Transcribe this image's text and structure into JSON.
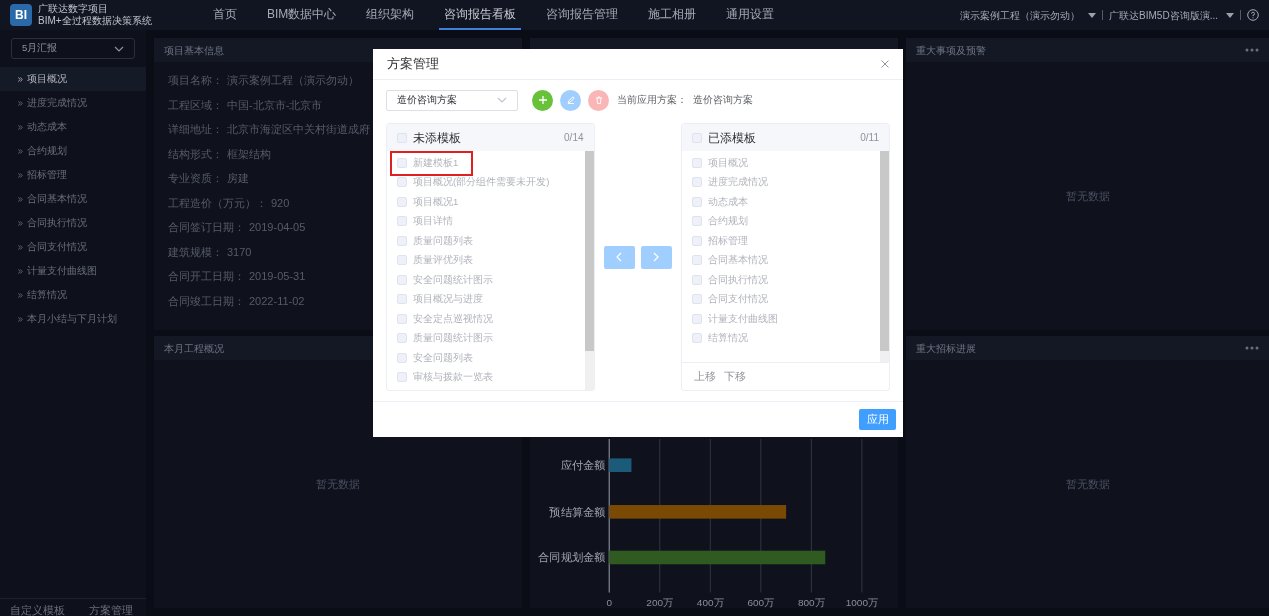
{
  "header": {
    "logo": "BI",
    "app_title": "广联达数字项目",
    "app_subtitle": "BIM+全过程数据决策系统",
    "nav": [
      {
        "label": "首页",
        "selected": false
      },
      {
        "label": "BIM数据中心",
        "selected": false
      },
      {
        "label": "组织架构",
        "selected": false
      },
      {
        "label": "咨询报告看板",
        "selected": true
      },
      {
        "label": "咨询报告管理",
        "selected": false
      },
      {
        "label": "施工相册",
        "selected": false
      },
      {
        "label": "通用设置",
        "selected": false
      }
    ],
    "project": "演示案例工程（演示勿动）",
    "company": "广联达BIM5D咨询版演..."
  },
  "sidebar": {
    "report_select": "5月汇报",
    "items": [
      {
        "label": "项目概况",
        "selected": true
      },
      {
        "label": "进度完成情况",
        "selected": false
      },
      {
        "label": "动态成本",
        "selected": false
      },
      {
        "label": "合约规划",
        "selected": false
      },
      {
        "label": "招标管理",
        "selected": false
      },
      {
        "label": "合同基本情况",
        "selected": false
      },
      {
        "label": "合同执行情况",
        "selected": false
      },
      {
        "label": "合同支付情况",
        "selected": false
      },
      {
        "label": "计量支付曲线图",
        "selected": false
      },
      {
        "label": "结算情况",
        "selected": false
      },
      {
        "label": "本月小结与下月计划",
        "selected": false
      }
    ],
    "footer_links": [
      "自定义模板",
      "方案管理"
    ]
  },
  "panels": {
    "basic_info": {
      "title": "项目基本信息",
      "rows": [
        {
          "label": "项目名称：",
          "value": "演示案例工程（演示勿动）"
        },
        {
          "label": "工程区域：",
          "value": "中国-北京市-北京市"
        },
        {
          "label": "详细地址：",
          "value": "北京市海淀区中关村街道成府"
        },
        {
          "label": "结构形式：",
          "value": "框架结构"
        },
        {
          "label": "专业资质：",
          "value": "房建"
        },
        {
          "label": "工程造价（万元）：",
          "value": "920"
        },
        {
          "label": "合同签订日期：",
          "value": "2019-04-05"
        },
        {
          "label": "建筑规模：",
          "value": "3170"
        },
        {
          "label": "合同开工日期：",
          "value": "2019-05-31"
        },
        {
          "label": "合同竣工日期：",
          "value": "2022-11-02"
        }
      ]
    },
    "monthly": {
      "title": "本月工程概况",
      "empty": "暂无数据"
    },
    "events": {
      "title": "重大事项及预警",
      "empty": "暂无数据"
    },
    "tenders": {
      "title": "重大招标进展",
      "empty": "暂无数据"
    },
    "amounts": {
      "chart_data": {
        "type": "bar",
        "orientation": "horizontal",
        "categories": [
          "应付金额",
          "预结算金额",
          "合同规划金额"
        ],
        "values": [
          88,
          700,
          855
        ],
        "grid": true,
        "xlim": [
          0,
          1000
        ],
        "xticks": [
          {
            "value": 0,
            "label": "0"
          },
          {
            "value": 200,
            "label": "200万"
          },
          {
            "value": 400,
            "label": "400万"
          },
          {
            "value": 600,
            "label": "600万"
          },
          {
            "value": 800,
            "label": "800万"
          },
          {
            "value": 1000,
            "label": "1000万"
          }
        ]
      }
    }
  },
  "modal": {
    "title": "方案管理",
    "plan_select": "造价咨询方案",
    "current_label": "当前应用方案：",
    "current_value": "造价咨询方案",
    "available": {
      "title": "未添模板",
      "count": "0/14",
      "checked": false,
      "items": [
        {
          "label": "新建模板1",
          "checked": false
        },
        {
          "label": "项目概况(部分组件需要未开发)",
          "checked": false
        },
        {
          "label": "项目概况1",
          "checked": false
        },
        {
          "label": "项目详情",
          "checked": false
        },
        {
          "label": "质量问题列表",
          "checked": false
        },
        {
          "label": "质量评优列表",
          "checked": false
        },
        {
          "label": "安全问题统计图示",
          "checked": false
        },
        {
          "label": "项目概况与进度",
          "checked": false
        },
        {
          "label": "安全定点巡视情况",
          "checked": false
        },
        {
          "label": "质量问题统计图示",
          "checked": false
        },
        {
          "label": "安全问题列表",
          "checked": false
        },
        {
          "label": "审核与拨款一览表",
          "checked": false
        }
      ]
    },
    "added": {
      "title": "已添模板",
      "count": "0/11",
      "checked": false,
      "items": [
        {
          "label": "项目概况",
          "checked": false
        },
        {
          "label": "进度完成情况",
          "checked": false
        },
        {
          "label": "动态成本",
          "checked": false
        },
        {
          "label": "合约规划",
          "checked": false
        },
        {
          "label": "招标管理",
          "checked": false
        },
        {
          "label": "合同基本情况",
          "checked": false
        },
        {
          "label": "合同执行情况",
          "checked": false
        },
        {
          "label": "合同支付情况",
          "checked": false
        },
        {
          "label": "计量支付曲线图",
          "checked": false
        },
        {
          "label": "结算情况",
          "checked": false
        }
      ],
      "move_up": "上移",
      "move_down": "下移"
    },
    "apply": "应用"
  }
}
